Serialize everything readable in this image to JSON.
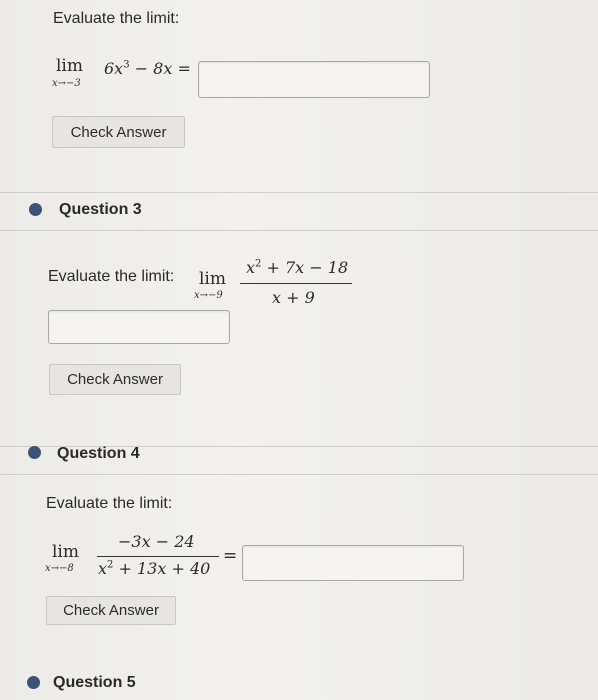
{
  "q2": {
    "prompt": "Evaluate the limit:",
    "lim": "lim",
    "sub": "x→−3",
    "expr_a": "6x",
    "expr_a_exp": "3",
    "expr_b": " − 8x =",
    "check": "Check Answer"
  },
  "q3": {
    "title": "Question 3",
    "prompt": "Evaluate the limit:",
    "lim": "lim",
    "sub": "x→−9",
    "num_a": "x",
    "num_exp": "2",
    "num_b": " + 7x − 18",
    "den": "x + 9",
    "check": "Check Answer"
  },
  "q4": {
    "title": "Question 4",
    "prompt": "Evaluate the limit:",
    "lim": "lim",
    "sub": "x→−8",
    "num": "−3x − 24",
    "den_a": "x",
    "den_exp": "2",
    "den_b": " + 13x + 40",
    "equals": "=",
    "check": "Check Answer"
  },
  "q5": {
    "title": "Question 5"
  },
  "colors": {
    "bullet": "#3b5376",
    "background": "#ecebe8",
    "button": "#e6e5e1"
  }
}
